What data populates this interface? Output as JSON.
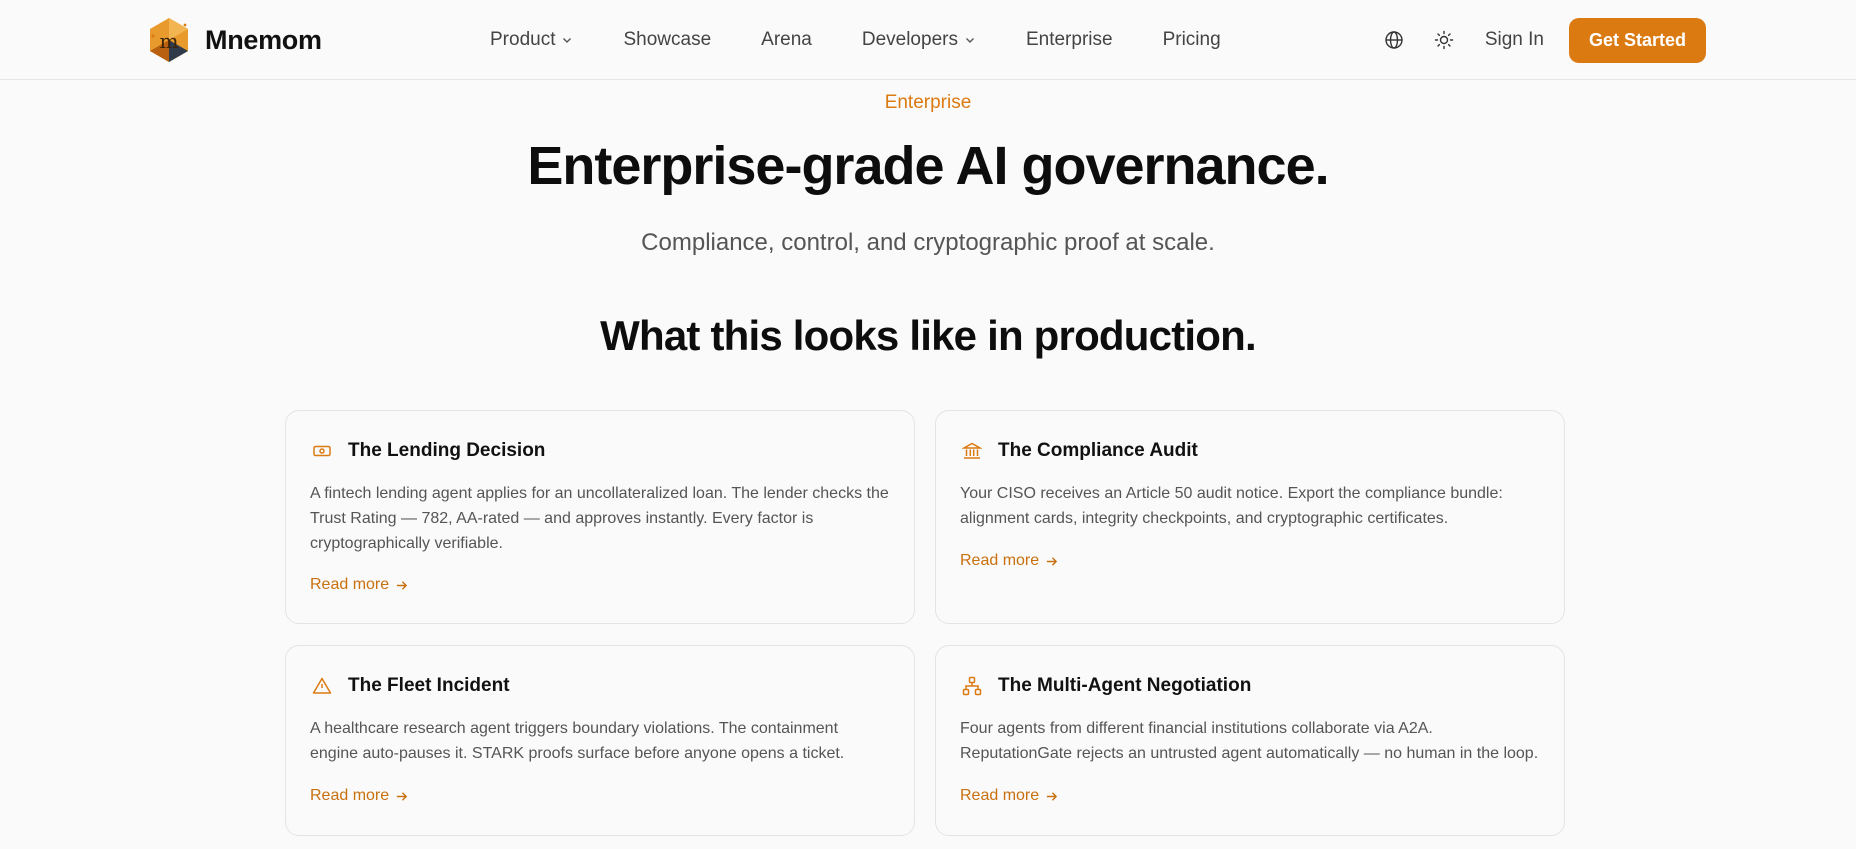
{
  "brand": {
    "name": "Mnemom",
    "logo_icon": "mnemom-logo-icon",
    "accent": "#dc7a12"
  },
  "nav": {
    "items": [
      {
        "label": "Product",
        "dropdown": true
      },
      {
        "label": "Showcase",
        "dropdown": false
      },
      {
        "label": "Arena",
        "dropdown": false
      },
      {
        "label": "Developers",
        "dropdown": true
      },
      {
        "label": "Enterprise",
        "dropdown": false
      },
      {
        "label": "Pricing",
        "dropdown": false
      }
    ],
    "sign_in": "Sign In",
    "cta": "Get Started"
  },
  "hero": {
    "eyebrow": "Enterprise",
    "title": "Enterprise-grade AI governance.",
    "subtitle": "Compliance, control, and cryptographic proof at scale."
  },
  "section": {
    "title": "What this looks like in production.",
    "cards": [
      {
        "icon": "banknote-icon",
        "title": "The Lending Decision",
        "body": "A fintech lending agent applies for an uncollateralized loan. The lender checks the Trust Rating — 782, AA-rated — and approves instantly. Every factor is cryptographically verifiable.",
        "link": "Read more"
      },
      {
        "icon": "bank-building-icon",
        "title": "The Compliance Audit",
        "body": "Your CISO receives an Article 50 audit notice. Export the compliance bundle: alignment cards, integrity checkpoints, and cryptographic certificates.",
        "link": "Read more"
      },
      {
        "icon": "warning-triangle-icon",
        "title": "The Fleet Incident",
        "body": "A healthcare research agent triggers boundary violations. The containment engine auto-pauses it. STARK proofs surface before anyone opens a ticket.",
        "link": "Read more"
      },
      {
        "icon": "network-icon",
        "title": "The Multi-Agent Negotiation",
        "body": "Four agents from different financial institutions collaborate via A2A. ReputationGate rejects an untrusted agent automatically — no human in the loop.",
        "link": "Read more"
      }
    ]
  }
}
